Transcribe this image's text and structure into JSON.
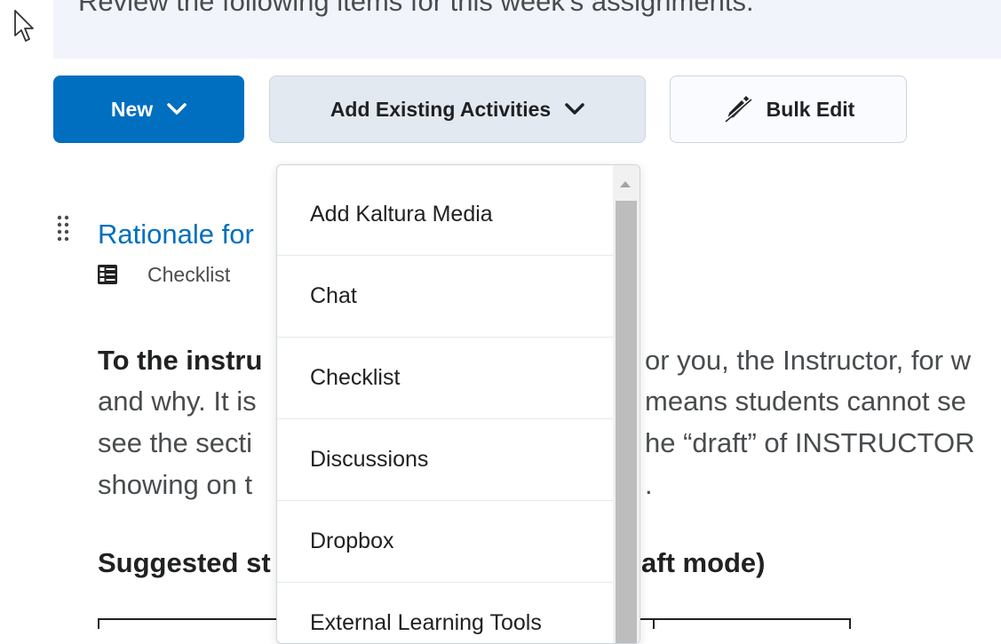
{
  "banner": {
    "text": "Review the following items for this week's assignments."
  },
  "toolbar": {
    "new_label": "New",
    "add_existing_label": "Add Existing Activities",
    "bulk_edit_label": "Bulk Edit"
  },
  "dropdown": {
    "items": [
      {
        "label": "Add Kaltura Media"
      },
      {
        "label": "Chat"
      },
      {
        "label": "Checklist"
      },
      {
        "label": "Discussions"
      },
      {
        "label": "Dropbox"
      },
      {
        "label": "External Learning Tools"
      }
    ]
  },
  "content_item": {
    "title": "Rationale for",
    "type": "Checklist"
  },
  "body": {
    "line1_bold": "To the instru",
    "line1_rest": "or you, the Instructor, for w",
    "line2_left": "and why. It is",
    "line2_right": "means students cannot se",
    "line3_left": "see the secti",
    "line3_right": "he “draft” of INSTRUCTOR",
    "line4_left": "showing on t",
    "line4_right": ".",
    "heading_left": "Suggested st",
    "heading_right": "aft mode)"
  },
  "colors": {
    "primary_button": "#006fbf",
    "link": "#006fbf",
    "secondary_button": "#e3e9f1",
    "banner_bg": "#f1f5fb"
  },
  "icons": {
    "cursor": "arrow-cursor-icon",
    "new_chevron": "chevron-down-icon",
    "add_chevron": "chevron-down-icon",
    "bulk_edit": "pencil-icon",
    "drag": "drag-handle-icon",
    "item_type": "checklist-icon"
  }
}
